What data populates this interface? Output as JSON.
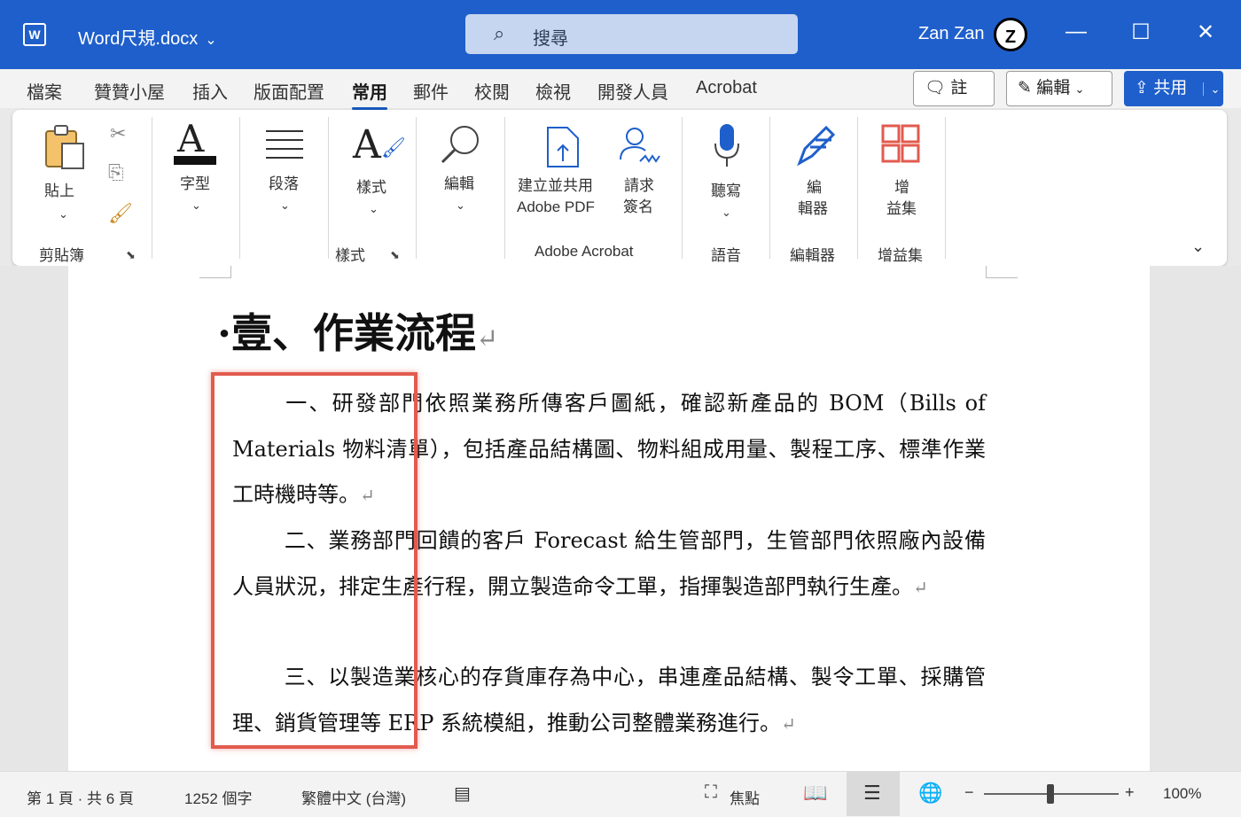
{
  "titlebar": {
    "app_icon": "word-icon",
    "app_icon_text": "W",
    "doc_title": "Word尺規.docx",
    "search_placeholder": "搜尋",
    "user": "Zan Zan",
    "avatar_text": "Z",
    "minimize": "—",
    "maximize": "☐",
    "close": "✕"
  },
  "menu": {
    "tabs": [
      "檔案",
      "贊贊小屋",
      "插入",
      "版面配置",
      "常用",
      "郵件",
      "校閱",
      "檢視",
      "開發人員",
      "Acrobat"
    ],
    "active_tab": "常用",
    "comment_btn": "註解",
    "edit_btn": "編輯",
    "share_btn": "共用"
  },
  "ribbon": {
    "paste": "貼上",
    "clipboard_group": "剪貼簿",
    "font": "字型",
    "paragraph": "段落",
    "styles": "樣式",
    "styles_group": "樣式",
    "editing": "編輯",
    "create_pdf_1": "建立並共用",
    "create_pdf_2": "Adobe PDF",
    "request_sign_1": "請求",
    "request_sign_2": "簽名",
    "acrobat_group": "Adobe Acrobat",
    "dictate": "聽寫",
    "voice_group": "語音",
    "editor_1": "編",
    "editor_2": "輯器",
    "editor_group": "編輯器",
    "addins_1": "增",
    "addins_2": "益集",
    "addins_group": "增益集"
  },
  "document": {
    "heading": "·壹、作業流程",
    "para1": "一、研發部門依照業務所傳客戶圖紙，確認新產品的 BOM（Bills of Materials  物料清單），包括產品結構圖、物料組成用量、製程工序、標準作業工時機時等。",
    "para2": "二、業務部門回饋的客戶 Forecast 給生管部門，生管部門依照廠內設備人員狀況，排定生產行程，開立製造命令工單，指揮製造部門執行生產。",
    "para3": "三、以製造業核心的存貨庫存為中心，串連產品結構、製令工單、採購管理、銷貨管理等 ERP 系統模組，推動公司整體業務進行。",
    "pilcrow": "↵"
  },
  "status": {
    "page": "第 1 頁 · 共 6 頁",
    "words": "1252 個字",
    "language": "繁體中文 (台灣)",
    "focus": "焦點",
    "zoom_minus": "−",
    "zoom_plus": "+",
    "zoom": "100%",
    "zoom_level": 1.0
  },
  "colors": {
    "title_bar": "#1f5fcb",
    "highlight_box": "#e25b4f"
  }
}
